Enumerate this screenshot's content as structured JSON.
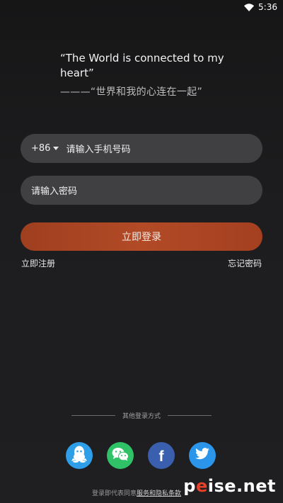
{
  "status_bar": {
    "time": "5:36"
  },
  "quote": {
    "english": "“The World is connected to my heart”",
    "chinese": "———“世界和我的心连在一起”"
  },
  "phone_field": {
    "country_code": "+86",
    "placeholder": "请输入手机号码"
  },
  "password_field": {
    "placeholder": "请输入密码"
  },
  "login_button": {
    "label": "立即登录"
  },
  "links": {
    "register": "立即注册",
    "forgot_password": "忘记密码"
  },
  "other_login": {
    "label": "其他登录方式",
    "providers": [
      "qq-icon",
      "wechat-icon",
      "facebook-icon",
      "twitter-icon"
    ]
  },
  "agreement": {
    "prefix": "登录即代表同意",
    "link": "服务和隐私条款"
  },
  "watermark": {
    "p": "p",
    "e": "e",
    "rest": "ise.net"
  },
  "colors": {
    "background": "#1d1d1f",
    "field_background": "#404043",
    "login_button": "#b24a26",
    "qq": "#2f9ee8",
    "wechat": "#2fc267",
    "facebook": "#3a5fae",
    "twitter": "#2b95e9"
  }
}
